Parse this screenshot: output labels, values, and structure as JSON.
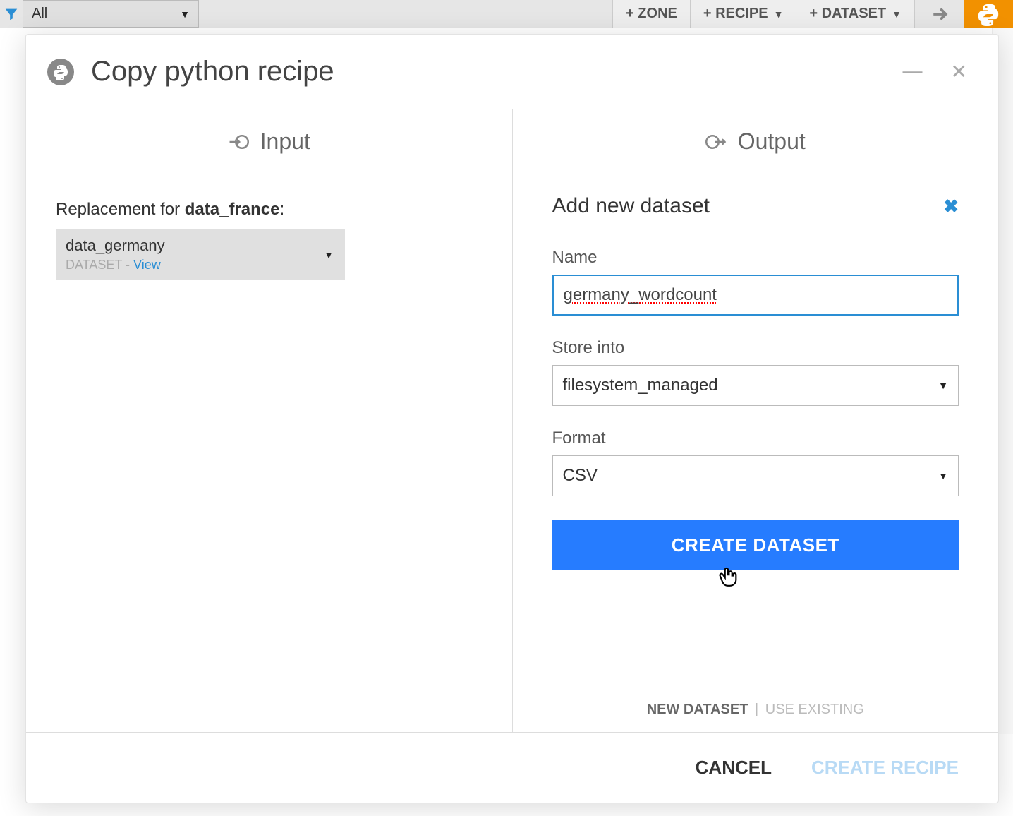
{
  "toolbar": {
    "filter_value": "All",
    "zone_btn": "+ ZONE",
    "recipe_btn": "+ RECIPE",
    "dataset_btn": "+ DATASET"
  },
  "modal": {
    "title": "Copy python recipe",
    "input_tab": "Input",
    "output_tab": "Output"
  },
  "input_panel": {
    "replacement_prefix": "Replacement for ",
    "replacement_target": "data_france",
    "selected_value": "data_germany",
    "meta_type": "DATASET",
    "meta_sep": " - ",
    "meta_view": "View"
  },
  "output_panel": {
    "heading": "Add new dataset",
    "name_label": "Name",
    "name_value": "germany_wordcount",
    "store_label": "Store into",
    "store_value": "filesystem_managed",
    "format_label": "Format",
    "format_value": "CSV",
    "create_dataset_btn": "CREATE DATASET",
    "tab_new": "NEW DATASET",
    "tab_existing": "USE EXISTING"
  },
  "footer": {
    "cancel": "CANCEL",
    "create_recipe": "CREATE RECIPE"
  }
}
